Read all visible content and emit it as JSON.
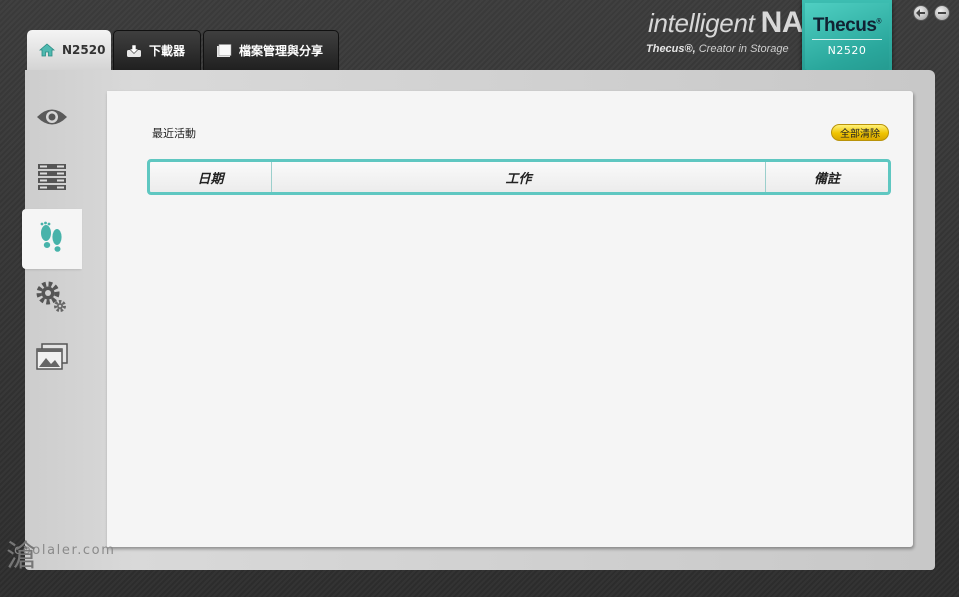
{
  "window": {
    "back_icon": "back-arrow-icon",
    "minimize_icon": "minimize-icon"
  },
  "brand": {
    "logo_intelligent": "intelligent",
    "logo_nas": "NAS",
    "tagline_brand": "Thecus®,",
    "tagline_rest": " Creator in Storage",
    "badge_logo": "Thecus",
    "badge_model": "N2520",
    "accent": "#3cbdb1"
  },
  "tabs": [
    {
      "label": "N2520",
      "icon": "home-icon",
      "active": true
    },
    {
      "label": "下載器",
      "icon": "download-tray-icon",
      "active": false
    },
    {
      "label": "檔案管理與分享",
      "icon": "folder-icon",
      "active": false
    }
  ],
  "sidebar": {
    "items": [
      {
        "icon": "eye-icon",
        "selected": false
      },
      {
        "icon": "server-list-icon",
        "selected": false
      },
      {
        "icon": "footprints-icon",
        "selected": true
      },
      {
        "icon": "gears-icon",
        "selected": false
      },
      {
        "icon": "windows-image-icon",
        "selected": false
      }
    ]
  },
  "main": {
    "section_title": "最近活動",
    "clear_all_label": "全部清除",
    "table": {
      "columns": [
        "日期",
        "工作",
        "備註"
      ],
      "rows": []
    }
  },
  "watermark": {
    "glyph": "滄",
    "text": "coolaler.com"
  }
}
